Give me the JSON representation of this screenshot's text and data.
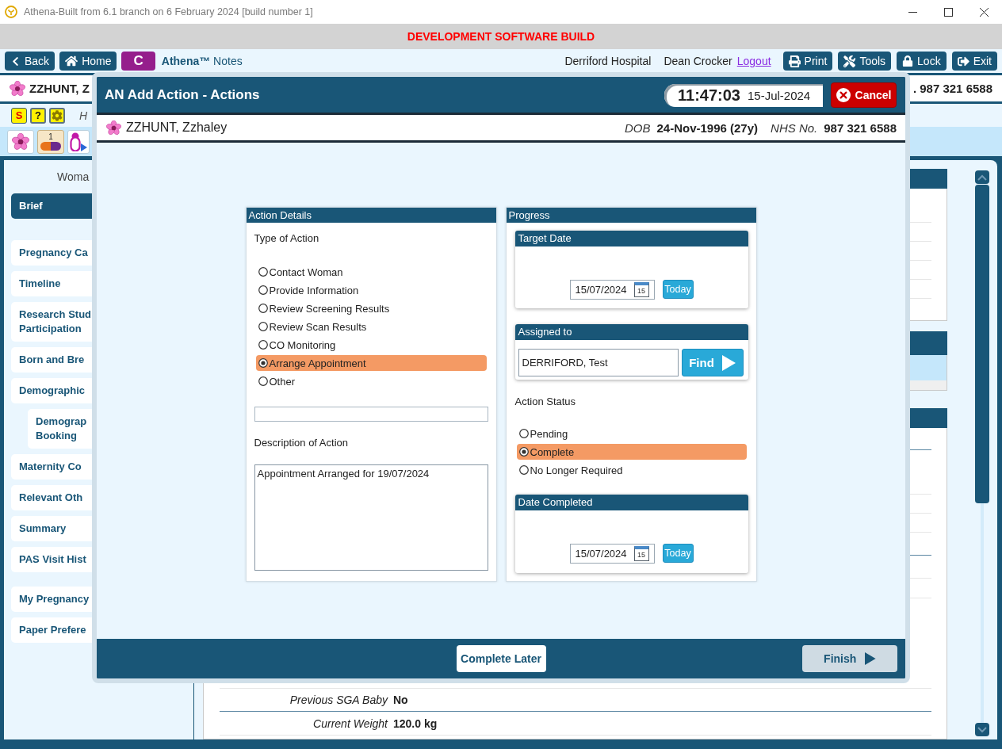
{
  "window": {
    "title": "Athena-Built from 6.1 branch on 6 February 2024 [build number 1]"
  },
  "banner": {
    "text": "DEVELOPMENT SOFTWARE BUILD"
  },
  "toolbar": {
    "nav_buttons": [
      {
        "kind": "back",
        "label": "Back"
      },
      {
        "kind": "home",
        "label": "Home"
      },
      {
        "kind": "letter",
        "label": "C"
      }
    ],
    "app_name": "**Athena™** Notes",
    "location": "Derriford Hospital",
    "user": "Dean Crocker",
    "logout": "Logout",
    "action_buttons": [
      {
        "kind": "print",
        "label": "Print"
      },
      {
        "kind": "tools",
        "label": "Tools"
      },
      {
        "kind": "lock",
        "label": "Lock"
      },
      {
        "kind": "exit",
        "label": "Exit"
      }
    ]
  },
  "patient_bar": {
    "name": "ZZHUNT, Z",
    "nhs_number": ". 987 321 6588"
  },
  "alert_icons": [
    {
      "kind": "letter",
      "glyph": "S"
    },
    {
      "kind": "help",
      "glyph": "?"
    },
    {
      "kind": "settings"
    }
  ],
  "hint_text": "H",
  "quick_tiles": [
    {
      "kind": "flower"
    },
    {
      "kind": "medication",
      "count": "1"
    },
    {
      "kind": "person"
    }
  ],
  "sidebar": {
    "heading": "Woma",
    "groups": [
      {
        "items": [
          {
            "label": "Brief",
            "selected": true
          }
        ]
      },
      {
        "items": [
          {
            "label": "Pregnancy Ca",
            "selected": false
          },
          {
            "label": "Timeline",
            "selected": false
          },
          {
            "label": "Research Stud\nParticipation",
            "selected": false
          },
          {
            "label": "Born and Bre",
            "selected": false
          },
          {
            "label": "Demographic",
            "selected": false,
            "children": [
              {
                "label": "Demograp\nBooking",
                "selected": false
              }
            ]
          },
          {
            "label": "Maternity Co",
            "selected": false
          },
          {
            "label": "Relevant Oth",
            "selected": false
          },
          {
            "label": "Summary",
            "selected": false
          },
          {
            "label": "PAS Visit Hist",
            "selected": false
          }
        ]
      },
      {
        "items": [
          {
            "label": "My Pregnancy",
            "selected": false
          },
          {
            "label": "Paper Prefere",
            "selected": false
          }
        ]
      }
    ]
  },
  "content": {
    "sections": [
      {
        "rows": [
          {
            "label": "Previous SGA Baby",
            "value": "No"
          }
        ]
      },
      {
        "rows": [
          {
            "label": "Current Weight",
            "value": "120.0 kg"
          }
        ]
      }
    ]
  },
  "dialog": {
    "title": "AN Add Action - Actions",
    "time": "11:47:03",
    "date": "15-Jul-2024",
    "cancel": "Cancel",
    "patient": {
      "name": "ZZHUNT, Zzhaley",
      "dob_label": "DOB",
      "dob": "24-Nov-1996 (27y)",
      "nhs_label": "NHS No.",
      "nhs_number": "987 321 6588"
    },
    "action_details": {
      "title": "Action Details",
      "type_label": "Type of Action",
      "types": [
        {
          "label": "Contact Woman",
          "selected": false
        },
        {
          "label": "Provide Information",
          "selected": false
        },
        {
          "label": "Review Screening Results",
          "selected": false
        },
        {
          "label": "Review Scan Results",
          "selected": false
        },
        {
          "label": "CO Monitoring",
          "selected": false
        },
        {
          "label": "Arrange Appointment",
          "selected": true
        },
        {
          "label": "Other",
          "selected": false
        }
      ],
      "description_label": "Description of Action",
      "description": "Appointment Arranged for 19/07/2024"
    },
    "progress": {
      "title": "Progress",
      "target_date": {
        "title": "Target Date",
        "value": "15/07/2024",
        "calendar_day": "15",
        "today": "Today"
      },
      "assigned_to": {
        "title": "Assigned to",
        "value": "DERRIFORD, Test",
        "find": "Find"
      },
      "status_label": "Action Status",
      "statuses": [
        {
          "label": "Pending",
          "selected": false
        },
        {
          "label": "Complete",
          "selected": true
        },
        {
          "label": "No Longer Required",
          "selected": false
        }
      ],
      "date_completed": {
        "title": "Date Completed",
        "value": "15/07/2024",
        "calendar_day": "15",
        "today": "Today"
      }
    },
    "footer": {
      "complete_later": "Complete Later",
      "finish": {
        "label": "Finish",
        "disabled": true
      }
    }
  }
}
